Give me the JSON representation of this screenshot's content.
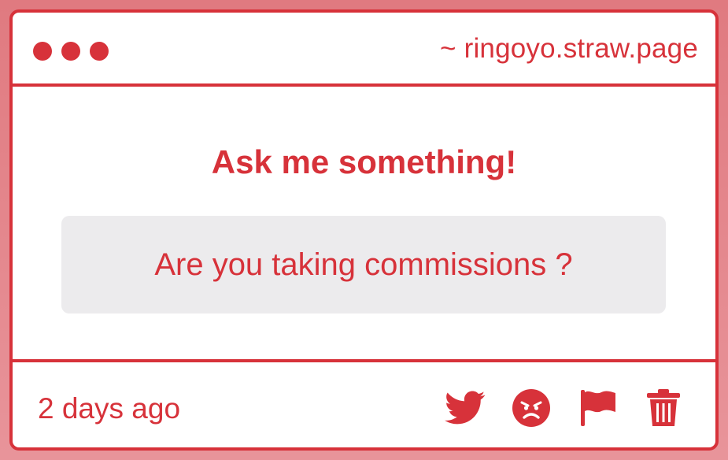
{
  "titlebar": {
    "url": "~ ringoyo.straw.page"
  },
  "main": {
    "prompt": "Ask me something!",
    "question": "Are you taking commissions ?"
  },
  "footer": {
    "timestamp": "2 days ago",
    "actions": [
      {
        "icon": "twitter-icon"
      },
      {
        "icon": "angry-face-icon"
      },
      {
        "icon": "flag-icon"
      },
      {
        "icon": "trash-icon"
      }
    ]
  },
  "colors": {
    "accent": "#d7323a",
    "background": "#e07a80",
    "question_box": "#ecebed"
  }
}
